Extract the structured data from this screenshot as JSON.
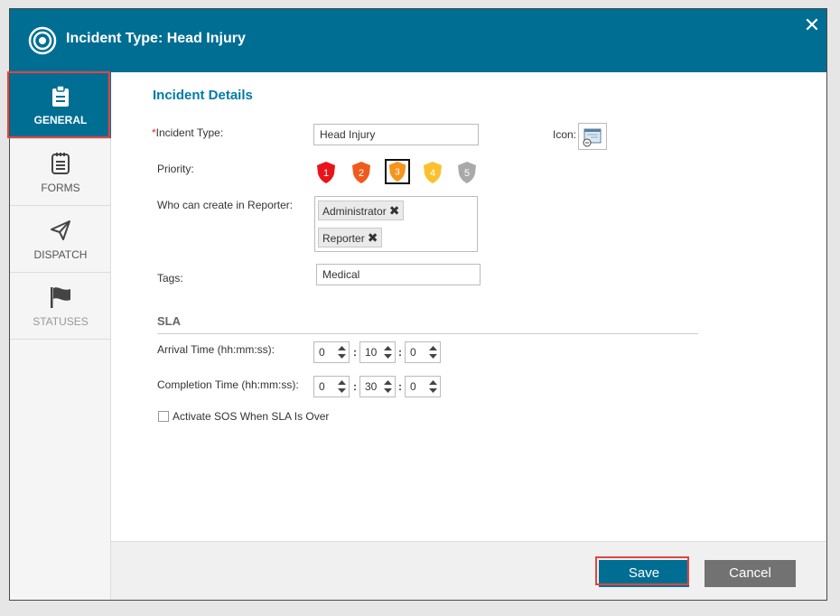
{
  "dialog": {
    "title": "Incident Type: Head Injury",
    "close_label": "✕"
  },
  "sidebar": {
    "items": [
      {
        "label": "GENERAL",
        "icon": "clipboard-icon",
        "state": "active"
      },
      {
        "label": "FORMS",
        "icon": "notepad-icon",
        "state": "normal"
      },
      {
        "label": "DISPATCH",
        "icon": "paper-plane-icon",
        "state": "normal"
      },
      {
        "label": "STATUSES",
        "icon": "flag-icon",
        "state": "disabled"
      }
    ]
  },
  "details": {
    "section_title": "Incident Details",
    "incident_type_required_mark": "*",
    "incident_type_label": "Incident Type:",
    "incident_type_value": "Head Injury",
    "icon_label": "Icon:",
    "priority_label": "Priority:",
    "priorities": [
      {
        "value": "1",
        "color": "#e8141a",
        "selected": false
      },
      {
        "value": "2",
        "color": "#f05a1c",
        "selected": false
      },
      {
        "value": "3",
        "color": "#f7941d",
        "selected": true
      },
      {
        "value": "4",
        "color": "#fbc02d",
        "selected": false
      },
      {
        "value": "5",
        "color": "#a9a9a9",
        "selected": false
      }
    ],
    "who_can_create_label": "Who can create in Reporter:",
    "creators": [
      {
        "label": "Administrator",
        "remove": "✖"
      },
      {
        "label": "Reporter",
        "remove": "✖"
      }
    ],
    "tags_label": "Tags:",
    "tags_value": "Medical"
  },
  "sla": {
    "title": "SLA",
    "arrival_label": "Arrival Time (hh:mm:ss):",
    "arrival": {
      "hh": "0",
      "mm": "10",
      "ss": "0"
    },
    "completion_label": "Completion Time (hh:mm:ss):",
    "completion": {
      "hh": "0",
      "mm": "30",
      "ss": "0"
    },
    "separator": ":",
    "sos_label": "Activate SOS When SLA Is Over",
    "sos_checked": false
  },
  "footer": {
    "save_label": "Save",
    "cancel_label": "Cancel"
  },
  "colors": {
    "accent": "#006e93",
    "section_title": "#007ba5",
    "highlight": "#e2453c",
    "cancel": "#727272"
  }
}
